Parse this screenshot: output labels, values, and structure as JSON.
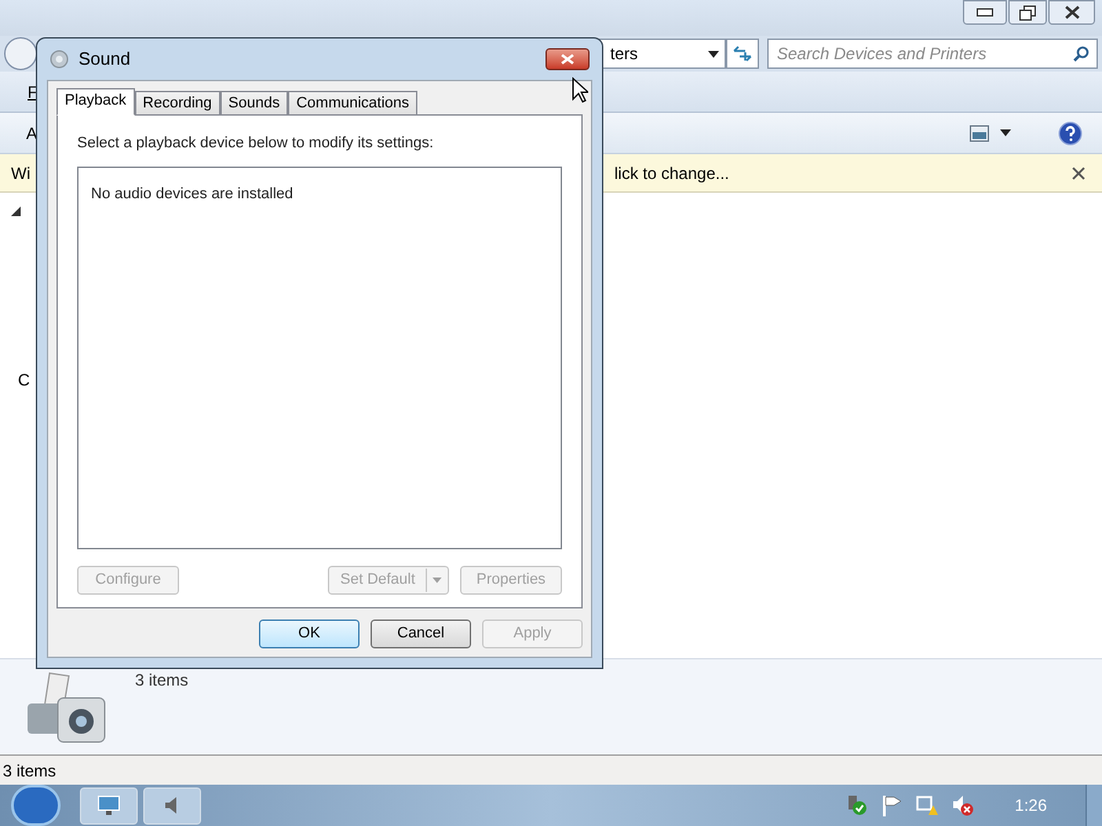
{
  "explorer": {
    "address_fragment": "ters",
    "search": {
      "placeholder": "Search Devices and Printers"
    },
    "menu_fragment": "F",
    "toolbar_fragment": "A",
    "info_bar": {
      "left_fragment": "Wi",
      "right_fragment": "lick to change..."
    },
    "content_fragment": "C",
    "details_count": "3 items",
    "status_bar": "3 items"
  },
  "dialog": {
    "title": "Sound",
    "tabs": [
      {
        "label": "Playback",
        "selected": true
      },
      {
        "label": "Recording",
        "selected": false
      },
      {
        "label": "Sounds",
        "selected": false
      },
      {
        "label": "Communications",
        "selected": false
      }
    ],
    "instruction": "Select a playback device below to modify its settings:",
    "empty_message": "No audio devices are installed",
    "device_buttons": [
      {
        "label": "Configure",
        "disabled": true,
        "kind": "plain"
      },
      {
        "label": "Set Default",
        "disabled": true,
        "kind": "split"
      },
      {
        "label": "Properties",
        "disabled": true,
        "kind": "plain"
      }
    ],
    "footer_buttons": [
      {
        "label": "OK",
        "disabled": false,
        "default": true
      },
      {
        "label": "Cancel",
        "disabled": false,
        "default": false
      },
      {
        "label": "Apply",
        "disabled": true,
        "default": false
      }
    ]
  },
  "taskbar": {
    "clock": "1:26"
  }
}
